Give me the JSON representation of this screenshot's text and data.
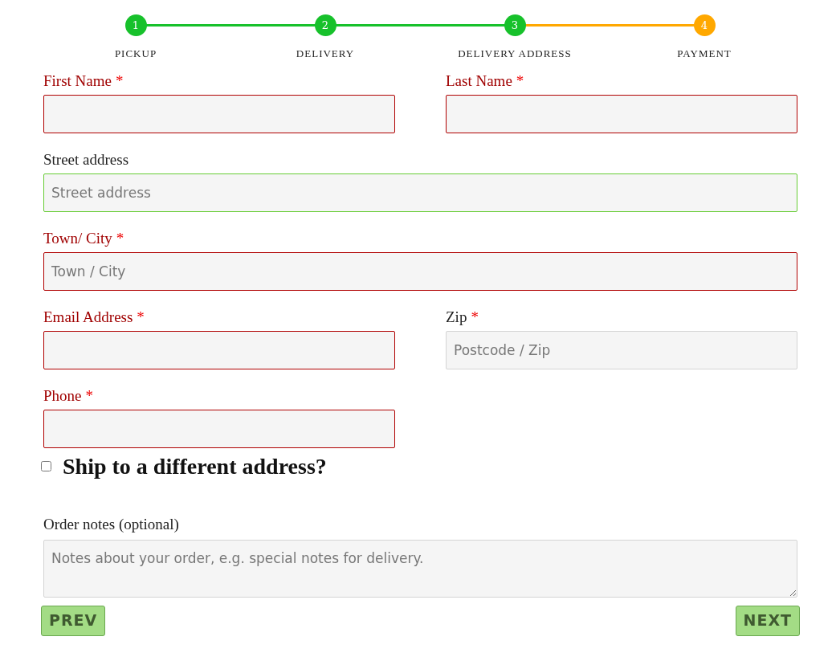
{
  "steps": [
    {
      "number": "1",
      "label": "PICKUP",
      "completed": true
    },
    {
      "number": "2",
      "label": "DELIVERY",
      "completed": true
    },
    {
      "number": "3",
      "label": "DELIVERY ADDRESS",
      "completed": true
    },
    {
      "number": "4",
      "label": "PAYMENT",
      "completed": false
    }
  ],
  "fields": [
    {
      "label": "First Name",
      "required_mark": "*",
      "invalid": true,
      "wide": false
    },
    {
      "label": "Last Name",
      "required_mark": "*",
      "invalid": true,
      "wide": false
    },
    {
      "label": "Street address",
      "invalid": false,
      "valid": true,
      "wide": true,
      "placeholder": "Street address"
    },
    {
      "label": "Town/ City",
      "required_mark": "*",
      "invalid": true,
      "wide": true,
      "placeholder": "Town / City"
    },
    {
      "label": "Email Address",
      "required_mark": "*",
      "invalid": true,
      "wide": false
    },
    {
      "label": "Zip",
      "required_mark": "*",
      "invalid": false,
      "valid": false,
      "wide": false,
      "placeholder": "Postcode / Zip"
    },
    {
      "label": "Phone",
      "required_mark": "*",
      "invalid": true,
      "wide": false
    }
  ],
  "ship_different": {
    "label": "Ship to a different address?",
    "checked": false
  },
  "order_notes": {
    "label": "Order notes (optional)",
    "placeholder": "Notes about your order, e.g. special notes for delivery."
  },
  "buttons": {
    "prev": "PREV",
    "next": "NEXT"
  }
}
